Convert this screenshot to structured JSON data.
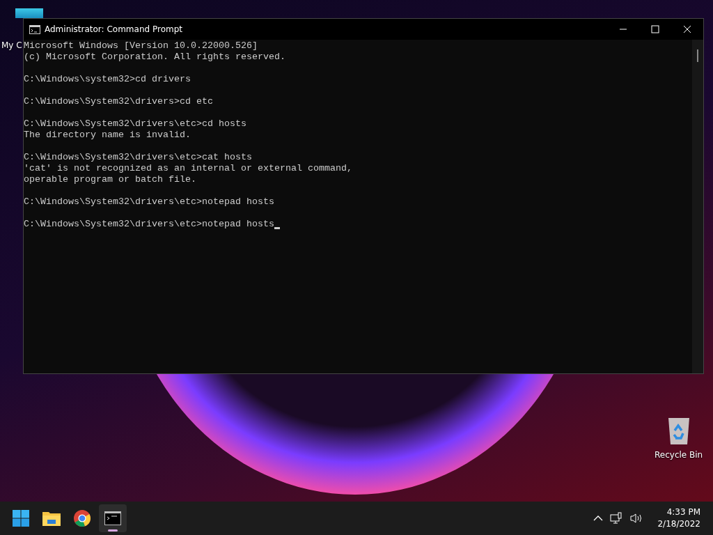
{
  "desktop": {
    "icons": [
      {
        "kind": "computer",
        "label": "My C"
      },
      {
        "kind": "recycle",
        "label": "Recycle Bin"
      }
    ]
  },
  "window": {
    "title": "Administrator: Command Prompt"
  },
  "console": {
    "blocks": [
      [
        "Microsoft Windows [Version 10.0.22000.526]",
        "(c) Microsoft Corporation. All rights reserved."
      ],
      [
        "C:\\Windows\\system32>cd drivers"
      ],
      [
        "C:\\Windows\\System32\\drivers>cd etc"
      ],
      [
        "C:\\Windows\\System32\\drivers\\etc>cd hosts",
        "The directory name is invalid."
      ],
      [
        "C:\\Windows\\System32\\drivers\\etc>cat hosts",
        "'cat' is not recognized as an internal or external command,",
        "operable program or batch file."
      ],
      [
        "C:\\Windows\\System32\\drivers\\etc>notepad hosts"
      ],
      [
        "C:\\Windows\\System32\\drivers\\etc>notepad hosts"
      ]
    ],
    "cursor_visible": true
  },
  "taskbar": {
    "apps": [
      {
        "kind": "start",
        "selected": false
      },
      {
        "kind": "folder",
        "selected": false
      },
      {
        "kind": "browser",
        "selected": false
      },
      {
        "kind": "terminal",
        "selected": true
      }
    ],
    "tray": {
      "time": "4:33 PM",
      "date": "2/18/2022"
    }
  }
}
